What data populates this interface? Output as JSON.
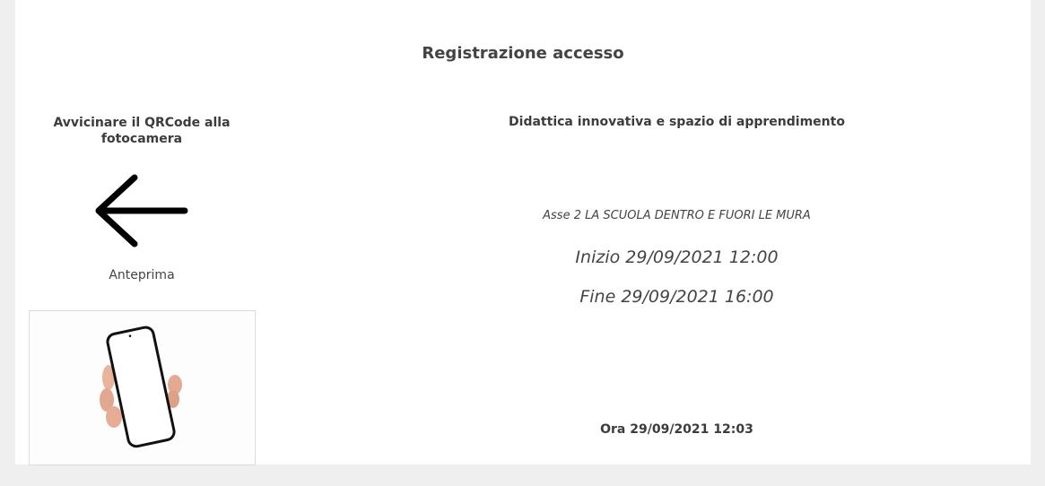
{
  "page": {
    "title": "Registrazione accesso"
  },
  "scanner": {
    "instruction": "Avvicinare il QRCode alla fotocamera",
    "arrow_icon": "arrow-left-icon",
    "preview_label": "Anteprima",
    "preview_icon": "hand-phone-icon"
  },
  "event": {
    "course_title": "Didattica innovativa e spazio di apprendimento",
    "axis": "Asse 2 LA SCUOLA DENTRO E FUORI LE MURA",
    "start": "Inizio 29/09/2021 12:00",
    "end": "Fine 29/09/2021 16:00",
    "now": "Ora 29/09/2021 12:03"
  }
}
